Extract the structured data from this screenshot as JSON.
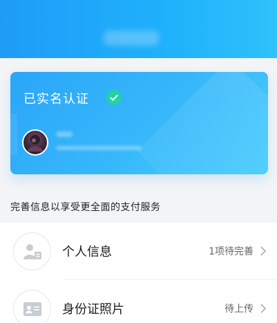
{
  "card": {
    "verified_label": "已实名认证"
  },
  "section": {
    "title": "完善信息以享受更全面的支付服务"
  },
  "rows": [
    {
      "label": "个人信息",
      "status": "1项待完善"
    },
    {
      "label": "身份证照片",
      "status": "待上传"
    }
  ],
  "colors": {
    "header": "#1fa8fa",
    "card_start": "#2aa6f8",
    "card_end": "#49cdfc",
    "check_green": "#24d1a6"
  }
}
